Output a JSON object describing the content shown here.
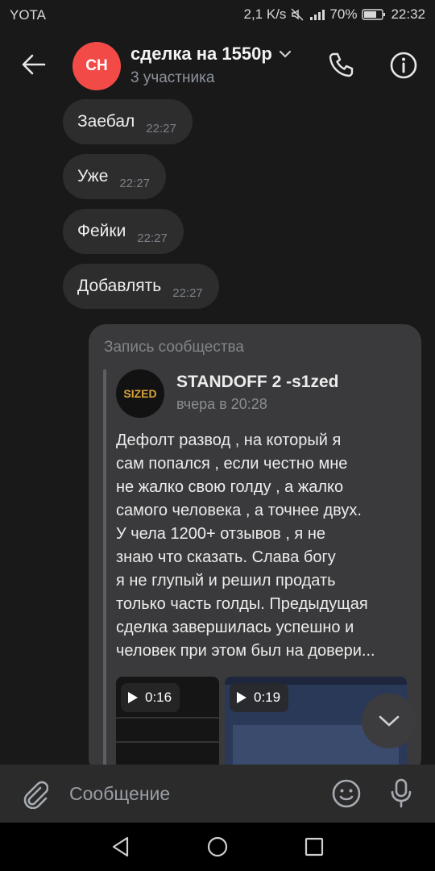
{
  "status_bar": {
    "carrier": "YOTA",
    "speed": "2,1 K/s",
    "battery": "70%",
    "time": "22:32"
  },
  "header": {
    "avatar_initials": "СН",
    "avatar_color": "#f24b47",
    "title": "сделка на 1550р",
    "subtitle": "3 участника"
  },
  "messages": [
    {
      "text": "Заебал",
      "time": "22:27"
    },
    {
      "text": "Уже",
      "time": "22:27"
    },
    {
      "text": "Фейки",
      "time": "22:27"
    },
    {
      "text": "Добавлять",
      "time": "22:27"
    }
  ],
  "post": {
    "header": "Запись сообщества",
    "avatar_text": "SIZED",
    "author": "STANDOFF 2 -s1zed",
    "date": "вчера в 20:28",
    "text_lines": [
      "Дефолт развод , на который я",
      "сам попался , если честно мне",
      "не жалко свою голду , а жалко",
      "самого человека , а точнее двух.",
      "У чела 1200+ отзывов , я не",
      "знаю что сказать. Слава богу",
      "я не глупый и решил продать",
      "только часть голды. Предыдущая",
      "сделка завершилась успешно и",
      "человек при этом был на довери..."
    ],
    "videos": [
      {
        "duration": "0:16"
      },
      {
        "duration": "0:19"
      }
    ]
  },
  "composer": {
    "placeholder": "Сообщение"
  },
  "icons": {
    "back": "arrow-left-icon",
    "call": "phone-icon",
    "info": "info-icon",
    "attach": "paperclip-icon",
    "emoji": "smiley-icon",
    "mic": "microphone-icon",
    "scroll": "chevron-down-icon"
  },
  "colors": {
    "background": "#19191a",
    "bubble": "#2d2d2e",
    "post_bubble": "#3a3a3c",
    "accent_avatar": "#f24b47"
  }
}
